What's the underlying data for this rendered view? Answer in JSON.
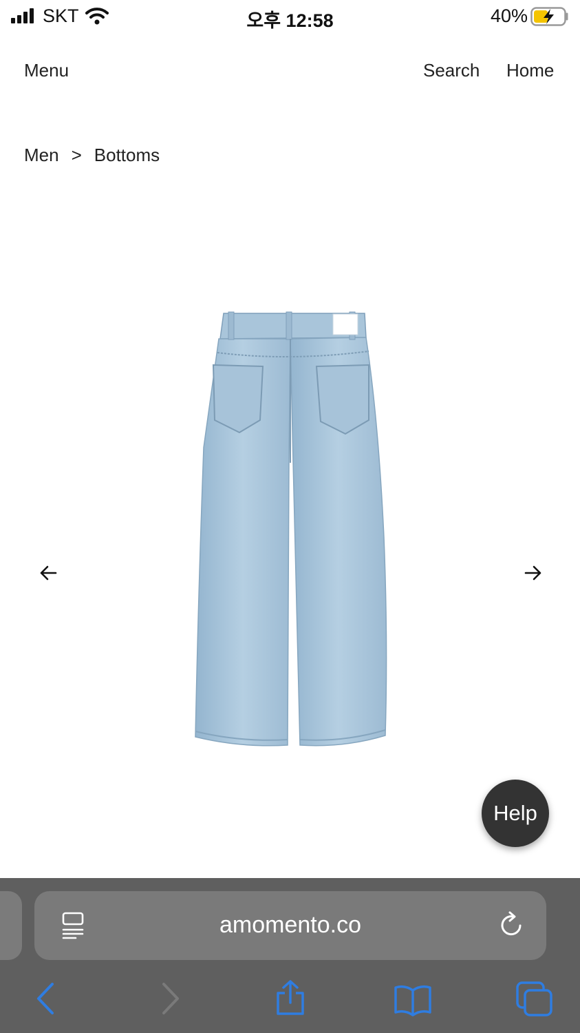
{
  "status_bar": {
    "carrier": "SKT",
    "time": "오후 12:58",
    "battery_percent": "40%"
  },
  "nav": {
    "menu": "Menu",
    "search": "Search",
    "home": "Home"
  },
  "breadcrumb": {
    "level1": "Men",
    "separator": ">",
    "level2": "Bottoms"
  },
  "product": {
    "image_icon": "jeans-back-view-icon",
    "denim_color": "#a7c4da"
  },
  "help_button": {
    "label": "Help"
  },
  "browser": {
    "url": "amomento.co",
    "accent_color": "#2f7de1"
  },
  "icons": {
    "prev": "arrow-left-icon",
    "next": "arrow-right-icon",
    "reader": "reader-icon",
    "reload": "reload-icon",
    "back": "back-icon",
    "forward": "forward-icon",
    "share": "share-icon",
    "bookmarks": "bookmarks-icon",
    "tabs": "tabs-icon"
  }
}
